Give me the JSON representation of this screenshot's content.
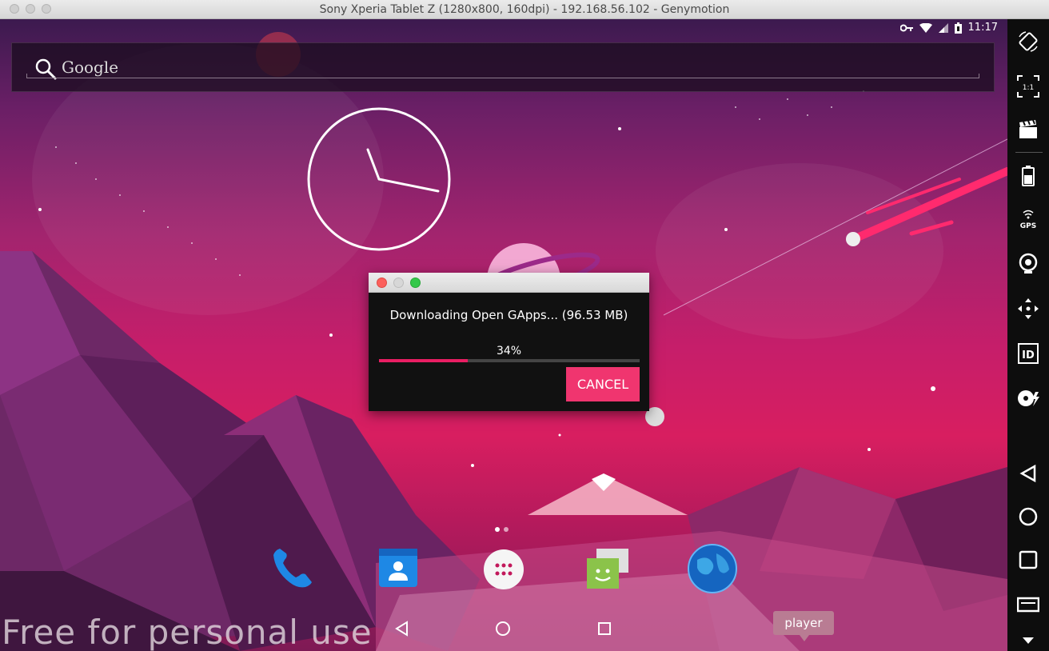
{
  "window": {
    "title": "Sony Xperia Tablet Z (1280x800, 160dpi) - 192.168.56.102 - Genymotion"
  },
  "statusbar": {
    "time": "11:17",
    "icons": [
      "vpn-key-icon",
      "wifi-icon",
      "signal-icon",
      "battery-icon"
    ]
  },
  "search": {
    "label": "Google",
    "icon": "search-icon"
  },
  "download_dialog": {
    "message": "Downloading Open GApps... (96.53 MB)",
    "progress_text": "34%",
    "progress": 0.34,
    "cancel_label": "CANCEL"
  },
  "dock": {
    "apps": [
      "phone-app-icon",
      "contacts-app-icon",
      "all-apps-icon",
      "messenger-app-icon",
      "browser-app-icon"
    ]
  },
  "watermark": "Free for personal use",
  "tooltip": "player",
  "toolbar": {
    "items": [
      "rotate-icon",
      "scale-1to1-icon",
      "screencast-icon",
      "battery-icon",
      "gps-icon",
      "webcam-icon",
      "remote-control-icon",
      "device-id-icon",
      "disk-io-icon",
      "back-icon",
      "home-icon",
      "recents-icon",
      "menu-icon",
      "more-icon"
    ],
    "gps_label": "GPS",
    "id_label": "ID",
    "scale_label": "1:1"
  },
  "colors": {
    "accent": "#f0356f",
    "progress": "#e91e63",
    "dialog_bg": "#111111"
  }
}
